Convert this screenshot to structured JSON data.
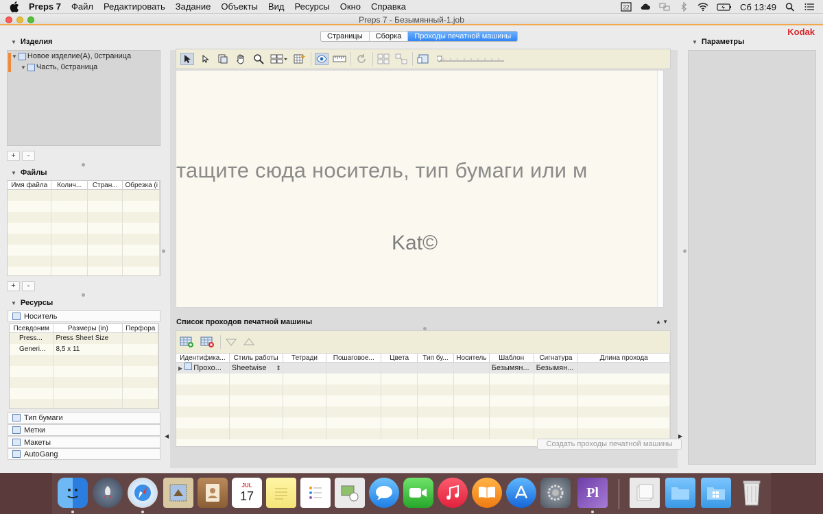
{
  "menubar": {
    "items": [
      "Preps 7",
      "Файл",
      "Редактировать",
      "Задание",
      "Объекты",
      "Вид",
      "Ресурсы",
      "Окно",
      "Справка"
    ],
    "clock": "Сб 13:49"
  },
  "window": {
    "title": "Preps 7 - Безымянный-1.job",
    "brand": "Kodak"
  },
  "products": {
    "heading": "Изделия",
    "tree": [
      "Новое изделие(A), 0страница",
      "Часть, 0страница"
    ],
    "add": "+",
    "remove": "-"
  },
  "files": {
    "heading": "Файлы",
    "columns": [
      "Имя файла",
      "Колич...",
      "Стран...",
      "Обрезка (i"
    ],
    "add": "+",
    "remove": "-"
  },
  "resources": {
    "heading": "Ресурсы",
    "active_tab": "Носитель",
    "columns": [
      "Псевдоним",
      "Размеры (in)",
      "Перфора"
    ],
    "rows": [
      [
        "Press...",
        "Press Sheet Size",
        ""
      ],
      [
        "Generi...",
        "8,5 x 11",
        ""
      ]
    ],
    "other_tabs": [
      "Тип бумаги",
      "Метки",
      "Макеты",
      "AutoGang"
    ]
  },
  "center": {
    "tabs": [
      "Страницы",
      "Сборка",
      "Проходы печатной машины"
    ],
    "active_tab_index": 2,
    "drop_hint": "тащите сюда носитель, тип бумаги или м",
    "watermark": "Kat©",
    "zoom_level": 0.0
  },
  "press_runs": {
    "heading": "Список проходов печатной машины",
    "columns": [
      "Идентифика...",
      "Стиль работы",
      "Тетради",
      "Пошаговое...",
      "Цвета",
      "Тип бу...",
      "Носитель",
      "Шаблон",
      "Сигнатура",
      "Длина прохода"
    ],
    "rows": [
      [
        "Прохо...",
        "Sheetwise",
        "",
        "",
        "",
        "",
        "",
        "Безымян...",
        "Безымян...",
        ""
      ]
    ],
    "create_button": "Создать проходы печатной машины"
  },
  "params": {
    "heading": "Параметры"
  },
  "dock": {
    "calendar_month": "JUL",
    "calendar_day": "17",
    "preps_label": "Pl"
  }
}
